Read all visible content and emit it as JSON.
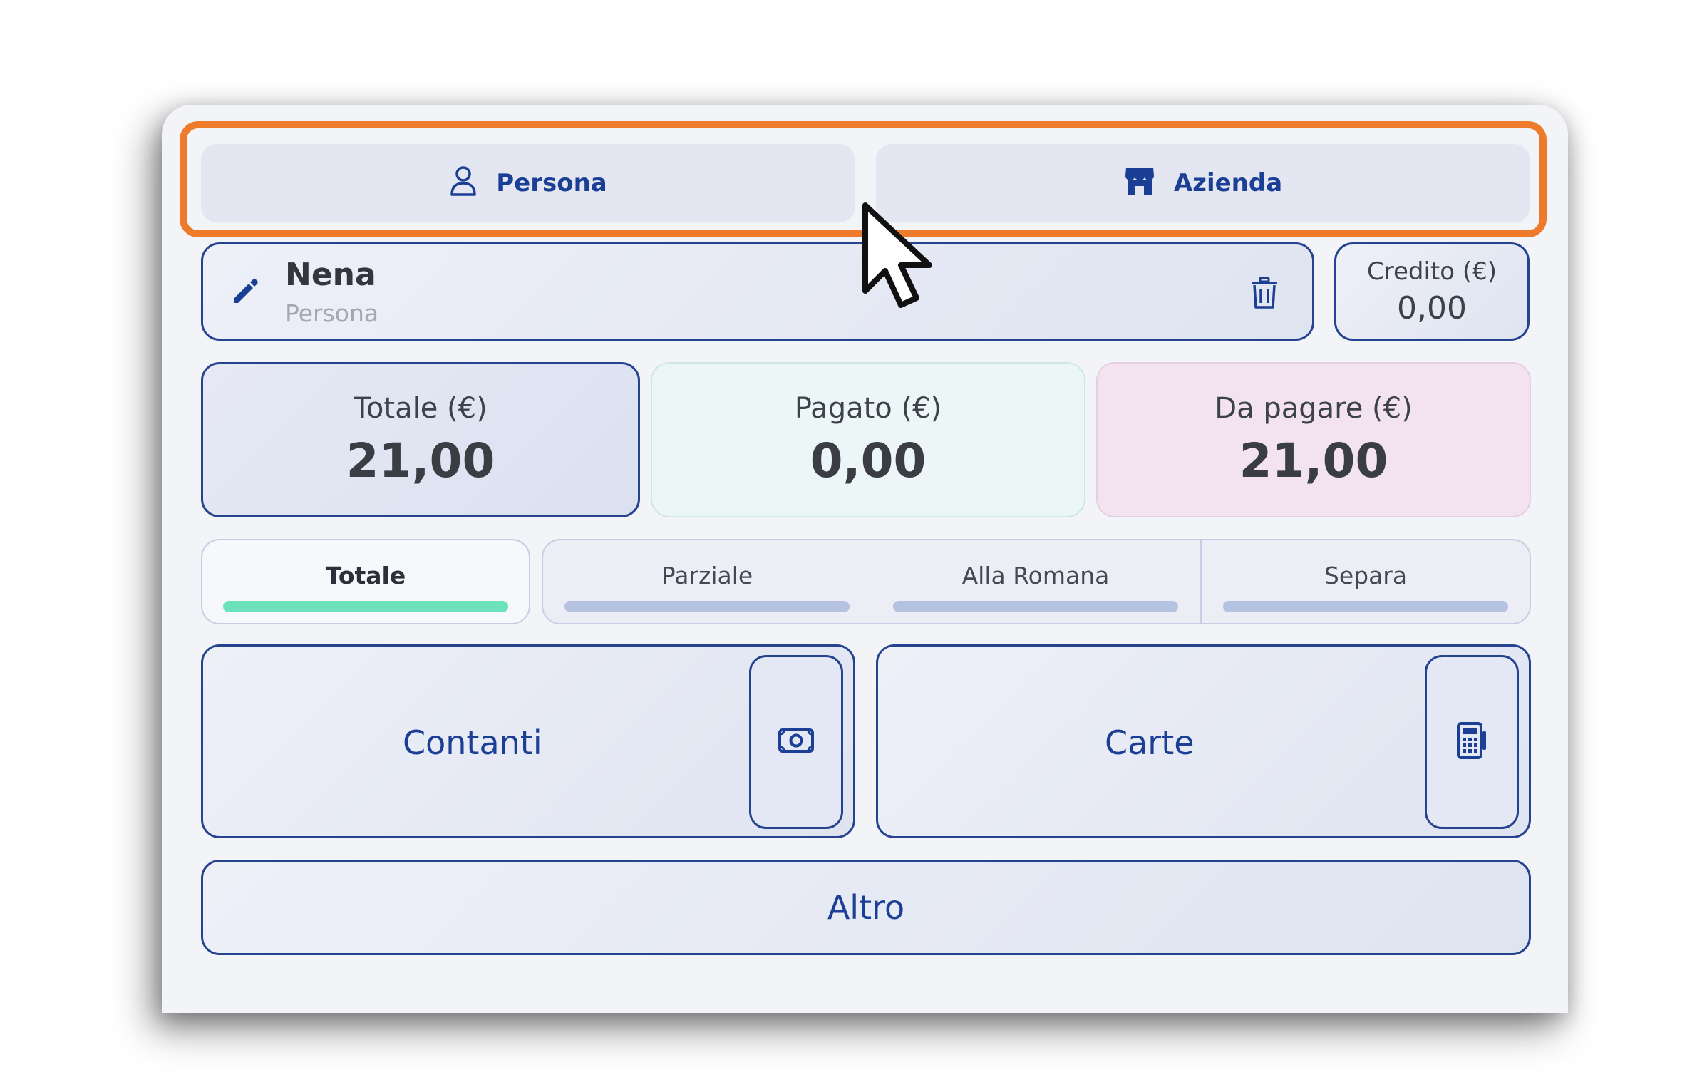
{
  "customer_type": {
    "person_label": "Persona",
    "company_label": "Azienda"
  },
  "customer": {
    "name": "Nena",
    "type": "Persona"
  },
  "credit": {
    "label": "Credito (€)",
    "value": "0,00"
  },
  "amounts": {
    "total_label": "Totale (€)",
    "total_value": "21,00",
    "paid_label": "Pagato (€)",
    "paid_value": "0,00",
    "due_label": "Da pagare (€)",
    "due_value": "21,00"
  },
  "split_modes": {
    "selected": "Totale",
    "items": [
      "Totale",
      "Parziale",
      "Alla Romana",
      "Separa"
    ]
  },
  "payment": {
    "cash_label": "Contanti",
    "card_label": "Carte",
    "other_label": "Altro"
  },
  "colors": {
    "accent": "#1b3f94",
    "highlight": "#ee7a2c",
    "active_tab_bar": "#6be2b9",
    "paid_bg": "#ecf6f6",
    "due_bg": "#f2e3ee"
  },
  "icons": {
    "person": "user-icon",
    "company": "store-icon",
    "edit": "pencil-icon",
    "delete": "trash-icon",
    "cash": "banknote-icon",
    "card": "card-terminal-icon"
  }
}
